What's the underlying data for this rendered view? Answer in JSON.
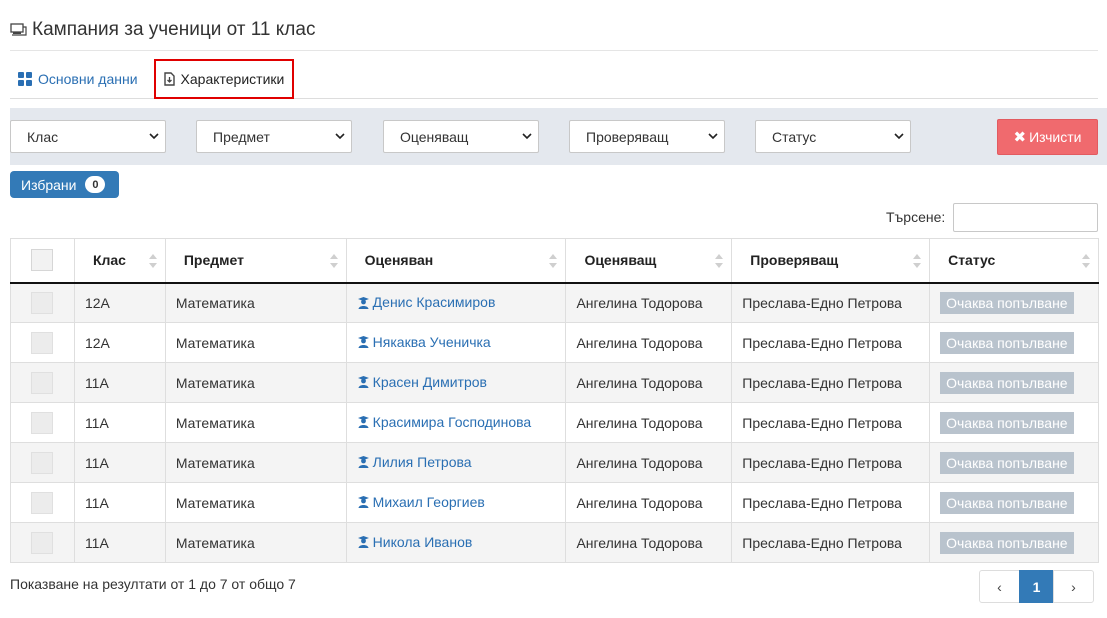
{
  "header": {
    "title": "Кампания за ученици от 11 клас",
    "icon": "campaign-icon"
  },
  "tabs": [
    {
      "label": "Основни данни",
      "icon": "grid-icon",
      "color": "#2a6fb3"
    },
    {
      "label": "Характеристики",
      "icon": "document-icon",
      "highlight": "#e00000"
    }
  ],
  "filters": {
    "class": "Клас",
    "subject": "Предмет",
    "grader": "Оценяващ",
    "reviewer": "Проверяващ",
    "status": "Статус",
    "clear_label": "Изчисти"
  },
  "favorites": {
    "label": "Избрани",
    "count": "0"
  },
  "search": {
    "label": "Търсене:",
    "value": ""
  },
  "table": {
    "headers": [
      "Клас",
      "Предмет",
      "Оценяван",
      "Оценяващ",
      "Проверяващ",
      "Статус"
    ],
    "rows": [
      {
        "class": "12А",
        "subject": "Математика",
        "student": "Денис Красимиров",
        "grader": "Ангелина Тодорова",
        "reviewer": "Преслава-Едно Петрова",
        "status": "Очаква попълване"
      },
      {
        "class": "12А",
        "subject": "Математика",
        "student": "Някаква Ученичка",
        "grader": "Ангелина Тодорова",
        "reviewer": "Преслава-Едно Петрова",
        "status": "Очаква попълване"
      },
      {
        "class": "11А",
        "subject": "Математика",
        "student": "Красен Димитров",
        "grader": "Ангелина Тодорова",
        "reviewer": "Преслава-Едно Петрова",
        "status": "Очаква попълване"
      },
      {
        "class": "11А",
        "subject": "Математика",
        "student": "Красимира Господинова",
        "grader": "Ангелина Тодорова",
        "reviewer": "Преслава-Едно Петрова",
        "status": "Очаква попълване"
      },
      {
        "class": "11А",
        "subject": "Математика",
        "student": "Лилия Петрова",
        "grader": "Ангелина Тодорова",
        "reviewer": "Преслава-Едно Петрова",
        "status": "Очаква попълване"
      },
      {
        "class": "11А",
        "subject": "Математика",
        "student": "Михаил Георгиев",
        "grader": "Ангелина Тодорова",
        "reviewer": "Преслава-Едно Петрова",
        "status": "Очаква попълване"
      },
      {
        "class": "11А",
        "subject": "Математика",
        "student": "Никола Иванов",
        "grader": "Ангелина Тодорова",
        "reviewer": "Преслава-Едно Петрова",
        "status": "Очаква попълване"
      }
    ]
  },
  "footer": {
    "summary": "Показване на резултати от 1 до 7 от общо 7",
    "pagination": {
      "prev": "‹",
      "current": "1",
      "next": "›"
    }
  },
  "colors": {
    "accent": "#337ab7",
    "danger": "#f06a6e",
    "status_badge": "#b9c3cd",
    "filter_bg": "#e4e8ee"
  }
}
